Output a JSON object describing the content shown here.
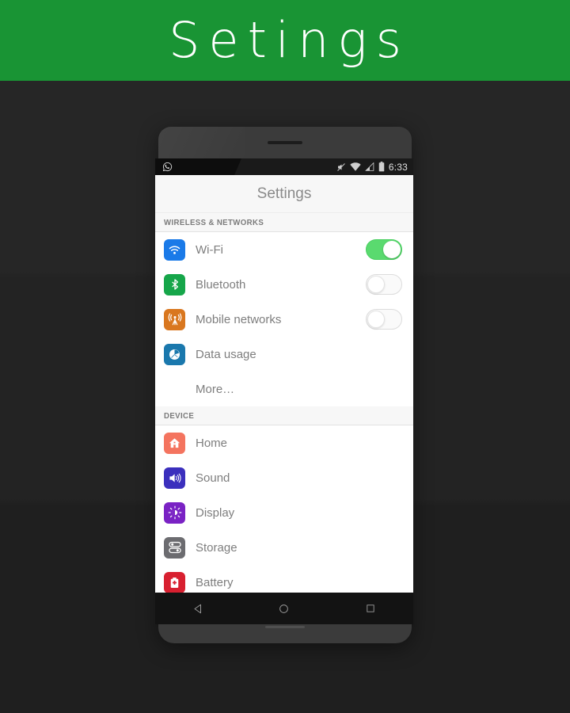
{
  "banner": {
    "title": "Setings",
    "color": "#199434"
  },
  "phone": {
    "statusbar": {
      "left_icon": "whatsapp-icon",
      "icons": [
        "mute-icon",
        "wifi-icon",
        "signal-icon",
        "battery-icon"
      ],
      "clock": "6:33"
    },
    "appbar": {
      "title": "Settings"
    },
    "navbar": {
      "back": "back-icon",
      "home": "home-icon",
      "recents": "recents-icon"
    },
    "sections": [
      {
        "header": "WIRELESS & NETWORKS",
        "rows": [
          {
            "label": "Wi-Fi",
            "icon": "wifi-icon",
            "icon_color": "#1a7ae8",
            "toggle": "on"
          },
          {
            "label": "Bluetooth",
            "icon": "bluetooth-icon",
            "icon_color": "#16a64a",
            "toggle": "off"
          },
          {
            "label": "Mobile networks",
            "icon": "cell-tower-icon",
            "icon_color": "#d9771f",
            "toggle": "off"
          },
          {
            "label": "Data usage",
            "icon": "data-usage-icon",
            "icon_color": "#1a78ad",
            "toggle": "none"
          },
          {
            "label": "More…",
            "icon": "none",
            "icon_color": "",
            "toggle": "none"
          }
        ]
      },
      {
        "header": "DEVICE",
        "rows": [
          {
            "label": "Home",
            "icon": "house-icon",
            "icon_color": "#f4745f",
            "toggle": "none"
          },
          {
            "label": "Sound",
            "icon": "speaker-icon",
            "icon_color": "#3b2fbd",
            "toggle": "none"
          },
          {
            "label": "Display",
            "icon": "sun-icon",
            "icon_color": "#7a22c4",
            "toggle": "none"
          },
          {
            "label": "Storage",
            "icon": "sliders-icon",
            "icon_color": "#6c6c70",
            "toggle": "none"
          },
          {
            "label": "Battery",
            "icon": "battery-icon",
            "icon_color": "#d82030",
            "toggle": "none"
          }
        ]
      }
    ]
  }
}
